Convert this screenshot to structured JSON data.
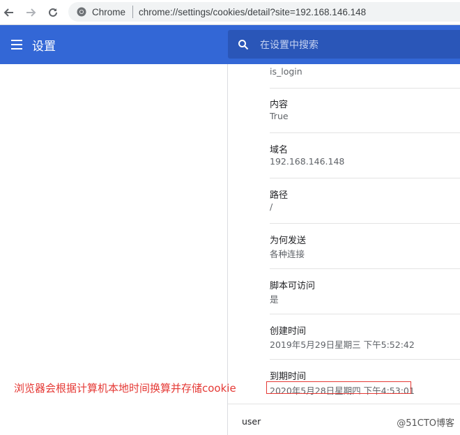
{
  "browser": {
    "site_name": "Chrome",
    "url": "chrome://settings/cookies/detail?site=192.168.146.148"
  },
  "settings": {
    "title": "设置",
    "search_placeholder": "在设置中搜索"
  },
  "cookie": {
    "name_value": "is_login",
    "fields": [
      {
        "label": "内容",
        "value": "True"
      },
      {
        "label": "域名",
        "value": "192.168.146.148"
      },
      {
        "label": "路径",
        "value": "/"
      },
      {
        "label": "为何发送",
        "value": "各种连接"
      },
      {
        "label": "脚本可访问",
        "value": "是"
      },
      {
        "label": "创建时间",
        "value": "2019年5月29日星期三 下午5:52:42"
      },
      {
        "label": "到期时间",
        "value": "2020年5月28日星期四 下午4:53:01"
      }
    ],
    "next_cookie": "user"
  },
  "annotation": "浏览器会根据计算机本地时间换算并存储cookie",
  "watermark": "@51CTO博客",
  "colors": {
    "header_blue": "#3367d6",
    "annotation_red": "#e53935"
  }
}
